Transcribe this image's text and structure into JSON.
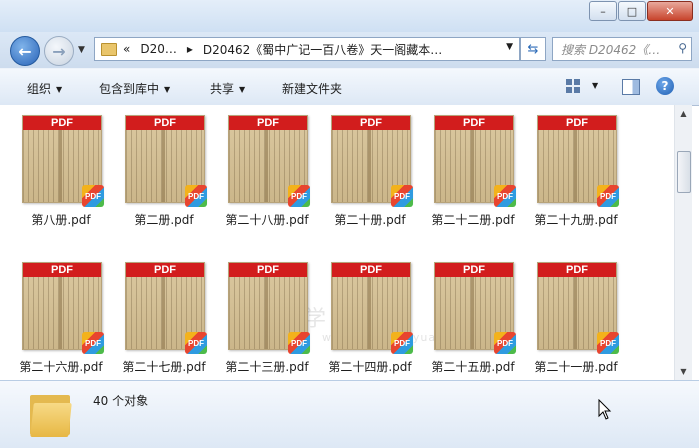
{
  "window": {
    "controls": [
      "minimize-icon",
      "maximize-icon",
      "close-icon"
    ]
  },
  "address": {
    "prefix": "«",
    "crumbs": [
      "D20…",
      "D20462《蜀中广记一百八卷》天一阁藏本…"
    ],
    "search_placeholder": "搜索 D20462《…"
  },
  "toolbar": {
    "organize": "组织",
    "include_library": "包含到库中",
    "share": "共享",
    "new_folder": "新建文件夹"
  },
  "files": [
    {
      "name": "第八册.pdf",
      "label": "PDF",
      "badge": "PDF"
    },
    {
      "name": "第二册.pdf",
      "label": "PDF",
      "badge": "PDF"
    },
    {
      "name": "第二十八册.pdf",
      "label": "PDF",
      "badge": "PDF"
    },
    {
      "name": "第二十册.pdf",
      "label": "PDF",
      "badge": "PDF"
    },
    {
      "name": "第二十二册.pdf",
      "label": "PDF",
      "badge": "PDF"
    },
    {
      "name": "第二十九册.pdf",
      "label": "PDF",
      "badge": "PDF"
    },
    {
      "name": "第二十六册.pdf",
      "label": "PDF",
      "badge": "PDF"
    },
    {
      "name": "第二十七册.pdf",
      "label": "PDF",
      "badge": "PDF"
    },
    {
      "name": "第二十三册.pdf",
      "label": "PDF",
      "badge": "PDF"
    },
    {
      "name": "第二十四册.pdf",
      "label": "PDF",
      "badge": "PDF"
    },
    {
      "name": "第二十五册.pdf",
      "label": "PDF",
      "badge": "PDF"
    },
    {
      "name": "第二十一册.pdf",
      "label": "PDF",
      "badge": "PDF"
    }
  ],
  "watermark": {
    "text": "国学资源网",
    "url": "www.guoxueziyuan.com"
  },
  "status": {
    "count": "40 个对象"
  },
  "colors": {
    "pdf_banner": "#d21d1d",
    "titlebar": "#cfe0f3"
  }
}
